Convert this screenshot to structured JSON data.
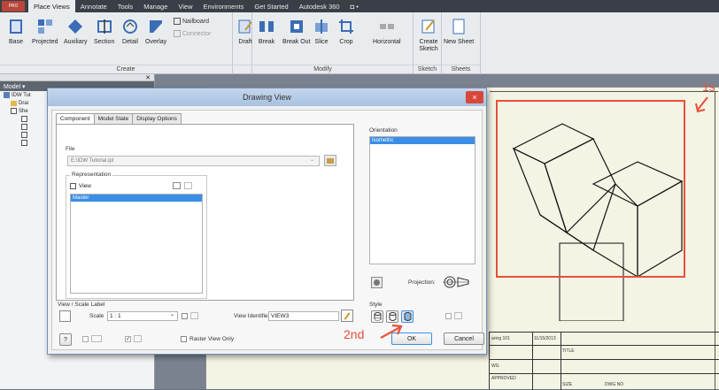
{
  "menu": {
    "app_label": "PRO",
    "tabs": [
      "Place Views",
      "Annotate",
      "Tools",
      "Manage",
      "View",
      "Environments",
      "Get Started",
      "Autodesk 360",
      "◘ •"
    ]
  },
  "ribbon": {
    "create": {
      "title": "Create",
      "tools": [
        "Base",
        "Projected",
        "Auxiliary",
        "Section",
        "Detail",
        "Overlay"
      ],
      "nailboard": "Nailboard",
      "connector": "Connector"
    },
    "modify": {
      "title": "Modify",
      "tools": [
        "Draft",
        "Break",
        "Break Out",
        "Slice",
        "Crop"
      ],
      "horizontal": "Horizontal"
    },
    "sketch": {
      "title": "Sketch",
      "tool": "Create Sketch"
    },
    "sheets": {
      "title": "Sheets",
      "tool": "New Sheet"
    }
  },
  "browser": {
    "header": "Model ▾",
    "items": [
      "IDW Tut",
      "Drai",
      "She"
    ]
  },
  "dialog": {
    "title": "Drawing View",
    "close": "×",
    "tabs": [
      "Component",
      "Model State",
      "Display Options"
    ],
    "file_label": "File",
    "file_value": "E:\\IDW Tutorial.ipt",
    "representation_label": "Representation",
    "view_label": "View",
    "view_selected": "Master",
    "orientation_label": "Orientation",
    "orientation_selected": "Isometric",
    "projection_label": "Projection:",
    "view_scale_label": "View / Scale Label",
    "scale_label": "Scale",
    "scale_value": "1 : 1",
    "view_identifier_label": "View Identifier",
    "view_identifier_value": "VIEW3",
    "style_label": "Style",
    "raster_label": "Raster View Only",
    "ok": "OK",
    "cancel": "Cancel",
    "help": "?"
  },
  "annotations": {
    "first": "1s",
    "second": "2nd"
  },
  "title_block": {
    "drawn_label": "aring 101",
    "date": "11/15/2013",
    "title": "TITLE",
    "check": "WG",
    "approved": "APPROVED",
    "size": "SIZE",
    "dwg_no": "DWG NO"
  },
  "colors": {
    "annotation": "#e8503a",
    "selection": "#3a8ee6",
    "menubar": "#3a3f47"
  }
}
